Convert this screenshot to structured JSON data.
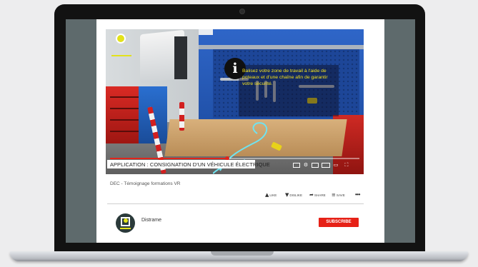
{
  "video": {
    "title": "APPLICATION : CONSIGNATION D'UN VÉHICULE ÉLECTRIQUE",
    "info_text": "Balisez votre zone de travail à l'aide de poteaux et d'une chaîne afin de garantir votre sécurité.",
    "info_icon": "info-icon",
    "progress_fraction": 0.47,
    "controls": [
      "subtitles-icon",
      "settings-icon",
      "miniplayer-icon",
      "theater-icon",
      "cast-icon",
      "fullscreen-icon"
    ]
  },
  "channel_line": "DEC - Témoignage formations VR",
  "actions": {
    "like": "LIKE",
    "dislike": "DISLIKE",
    "share": "SHARE",
    "save": "SAVE",
    "more": "•••"
  },
  "channel": {
    "name": "Distrame",
    "subscribe": "SUBSCRIBE"
  },
  "colors": {
    "accent_red": "#e1251b",
    "subscribe_red": "#e62117",
    "info_yellow": "#f5e21b",
    "logo_yellow": "#e3e21b"
  }
}
